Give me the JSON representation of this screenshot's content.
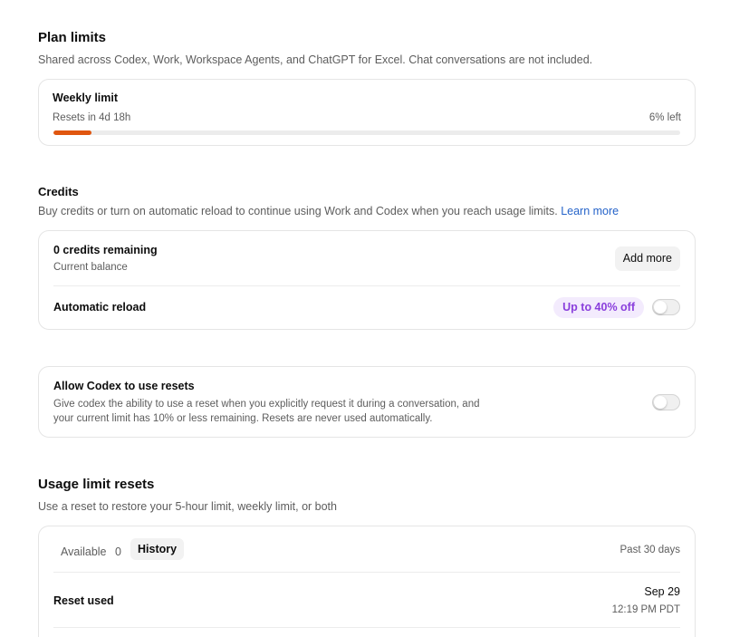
{
  "plan_limits": {
    "title": "Plan limits",
    "description": "Shared across Codex, Work, Workspace Agents, and ChatGPT for Excel. Chat conversations are not included.",
    "weekly": {
      "label": "Weekly limit",
      "resets": "Resets in 4d 18h",
      "left_text": "6% left",
      "progress_fraction": 0.06,
      "progress_color": "#e0560f"
    }
  },
  "credits": {
    "title": "Credits",
    "description": "Buy credits or turn on automatic reload to continue using Work and Codex when you reach usage limits.",
    "learn_more": "Learn more",
    "balance_title": "0 credits remaining",
    "balance_sub": "Current balance",
    "add_more": "Add more",
    "auto_reload_label": "Automatic reload",
    "discount_badge": "Up to 40% off",
    "auto_reload_on": false
  },
  "codex_resets": {
    "title": "Allow Codex to use resets",
    "description_line1": "Give codex the ability to use a reset when you explicitly request it during a conversation, and",
    "description_line2": "your current limit has 10% or less remaining. Resets are never used automatically.",
    "enabled": false
  },
  "usage_resets": {
    "title": "Usage limit resets",
    "description": "Use a reset to restore your 5-hour limit, weekly limit, or both",
    "tabs": {
      "available_label": "Available",
      "available_count": "0",
      "history_label": "History"
    },
    "period": "Past 30 days",
    "rows": [
      {
        "label": "Reset used",
        "date": "Sep 29",
        "time": "12:19 PM PDT"
      }
    ]
  },
  "colors": {
    "accent_orange": "#e0560f",
    "link_blue": "#2563c9",
    "badge_purple": "#8a3fdc"
  }
}
